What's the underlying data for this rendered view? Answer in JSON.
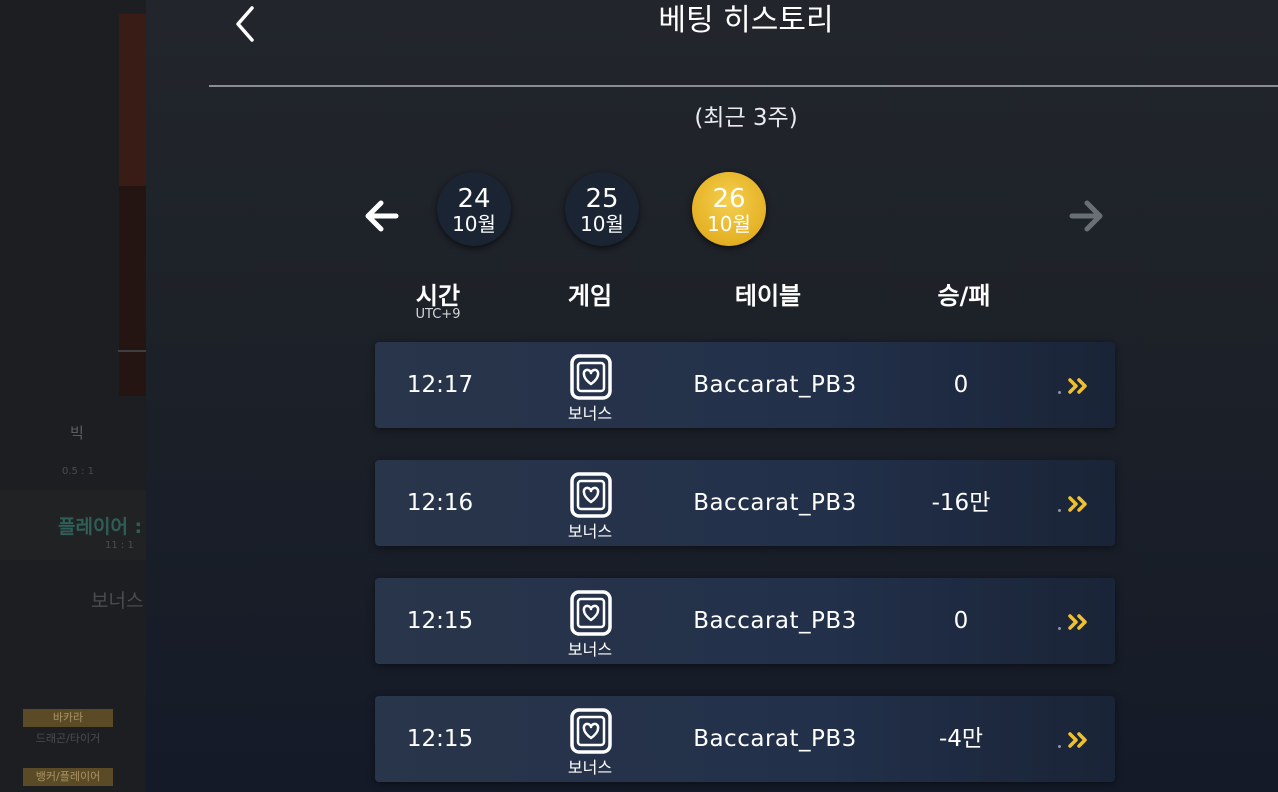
{
  "background": {
    "texts": [
      "빅",
      "0.5 : 1",
      "플레이어 :",
      "11 : 1",
      "보너스",
      "바카라",
      "드래곤/타이거",
      "뱅커/플레이어"
    ]
  },
  "header": {
    "title": "베팅 히스토리",
    "back_icon": "chevron-left-icon"
  },
  "range_label": "(최근 3주)",
  "date_selector": {
    "prev_icon": "arrow-left-icon",
    "next_icon": "arrow-right-icon",
    "dates": [
      {
        "day": "24",
        "month": "10월",
        "active": false
      },
      {
        "day": "25",
        "month": "10월",
        "active": false
      },
      {
        "day": "26",
        "month": "10월",
        "active": true
      }
    ]
  },
  "columns": {
    "time": "시간",
    "time_sub": "UTC+9",
    "game": "게임",
    "table": "테이블",
    "result": "승/패"
  },
  "rows": [
    {
      "time": "12:17",
      "game": "보너스",
      "table": "Baccarat_PB3",
      "result": "0"
    },
    {
      "time": "12:16",
      "game": "보너스",
      "table": "Baccarat_PB3",
      "result": "-16만"
    },
    {
      "time": "12:15",
      "game": "보너스",
      "table": "Baccarat_PB3",
      "result": "0"
    },
    {
      "time": "12:15",
      "game": "보너스",
      "table": "Baccarat_PB3",
      "result": "-4만"
    }
  ],
  "colors": {
    "accent": "#e4b124",
    "detail_arrow": "#f0c12c",
    "row_bg": "#26324a"
  }
}
